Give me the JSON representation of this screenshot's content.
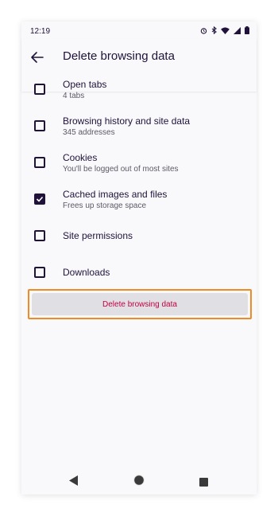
{
  "status_bar": {
    "time": "12:19",
    "icons": [
      "alarm-icon",
      "bluetooth-icon",
      "wifi-icon",
      "signal-icon",
      "battery-icon"
    ]
  },
  "header": {
    "back_icon": "arrow-left-icon",
    "title": "Delete browsing data"
  },
  "options": [
    {
      "label": "Open tabs",
      "sublabel": "4 tabs",
      "checked": false
    },
    {
      "label": "Browsing history and site data",
      "sublabel": "345 addresses",
      "checked": false
    },
    {
      "label": "Cookies",
      "sublabel": "You'll be logged out of most sites",
      "checked": false
    },
    {
      "label": "Cached images and files",
      "sublabel": "Frees up storage space",
      "checked": true
    },
    {
      "label": "Site permissions",
      "sublabel": "",
      "checked": false
    },
    {
      "label": "Downloads",
      "sublabel": "",
      "checked": false
    }
  ],
  "delete_button": {
    "label": "Delete browsing data"
  },
  "navigation": {
    "back_icon": "triangle-back-icon",
    "home_icon": "circle-home-icon",
    "recents_icon": "square-recents-icon"
  },
  "colors": {
    "text": "#20123a",
    "accent": "#c50042",
    "highlight": "#f08a24",
    "button_bg": "#e0dfe4",
    "background": "#f9f9fb"
  }
}
